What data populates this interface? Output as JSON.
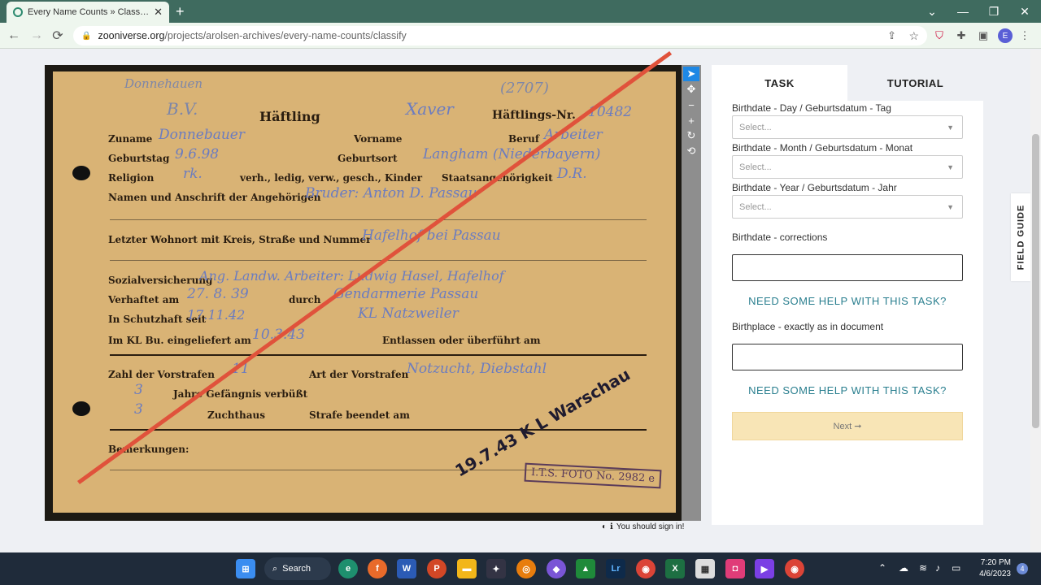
{
  "browser": {
    "tab_title": "Every Name Counts » Classify —",
    "url_domain": "zooniverse.org",
    "url_path": "/projects/arolsen-archives/every-name-counts/classify",
    "avatar_letter": "E"
  },
  "document": {
    "header_left": "Donnehauen",
    "bv": "B.V.",
    "haeftling": "Häftling",
    "vorname_hand": "Xaver",
    "number_top": "(2707)",
    "haeftlings_nr": "Häftlings-Nr.",
    "nr_value": "10482",
    "rows": [
      {
        "label": "Zuname",
        "value": "Donnebauer"
      },
      {
        "label": "Geburtstag",
        "value": "9.6.98"
      },
      {
        "label": "Religion",
        "value": "rk."
      },
      {
        "label": "Namen und Anschrift der Angehörigen",
        "value": "Bruder: Anton D. Passau"
      },
      {
        "label": "Letzter Wohnort mit Kreis, Straße und Nummer",
        "value": "Hafelhof bei Passau"
      },
      {
        "label": "Sozialversicherung",
        "value": "Ang. Landw. Arbeiter: Ludwig Hasel, Hafelhof"
      },
      {
        "label": "Verhaftet am",
        "value": "27. 8. 39"
      },
      {
        "label": "In Schutzhaft seit",
        "value": "17.11.42"
      },
      {
        "label": "Im KL Bu. eingeliefert am",
        "value": "10.3.43"
      },
      {
        "label": "Zahl der Vorstrafen",
        "value": "11"
      },
      {
        "label": "Jahre Gefängnis verbüßt",
        "value": "3"
      },
      {
        "label": "Zuchthaus",
        "value": "3"
      },
      {
        "label": "Bemerkungen:",
        "value": ""
      }
    ],
    "beruf_label": "Beruf",
    "beruf_value": "Arbeiter",
    "vorname_label": "Vorname",
    "geburtsort_label": "Geburtsort",
    "geburtsort_value": "Langham (Niederbayern)",
    "staatsang_label": "Staatsangehörigkeit",
    "staatsang_value": "D.R.",
    "verh_label": "verh., ledig, verw., gesch., Kinder",
    "durch_label": "durch",
    "durch_value": "Gendarmerie Passau",
    "kl_value": "KL Natzweiler",
    "entlassen_label": "Entlassen oder überführt am",
    "art_label": "Art der Vorstrafen",
    "art_value": "Notzucht, Diebstahl",
    "strafe_label": "Strafe beendet am",
    "stamp_text": "19.7.43 K L Warschau",
    "foto_text": "I.T.S. FOTO No. 2982 e"
  },
  "viewer_tools": [
    "pointer-icon",
    "move-icon",
    "zoom-out-icon",
    "zoom-in-icon",
    "rotate-icon",
    "reset-icon"
  ],
  "signin_text": "You should sign in!",
  "panel": {
    "tab_task": "TASK",
    "tab_tutorial": "TUTORIAL",
    "fields": [
      {
        "label": "Birthdate - Day / Geburtsdatum - Tag",
        "placeholder": "Select..."
      },
      {
        "label": "Birthdate - Month / Geburtsdatum - Monat",
        "placeholder": "Select..."
      },
      {
        "label": "Birthdate - Year / Geburtsdatum - Jahr",
        "placeholder": "Select..."
      }
    ],
    "corrections_label": "Birthdate - corrections",
    "help1": "NEED SOME HELP WITH THIS TASK?",
    "birthplace_label": "Birthplace - exactly as in document",
    "help2": "NEED SOME HELP WITH THIS TASK?",
    "next_label": "Next ➞"
  },
  "field_guide": "FIELD GUIDE",
  "taskbar": {
    "search_label": "Search",
    "time": "7:20 PM",
    "date": "4/6/2023",
    "notifications": "4"
  }
}
